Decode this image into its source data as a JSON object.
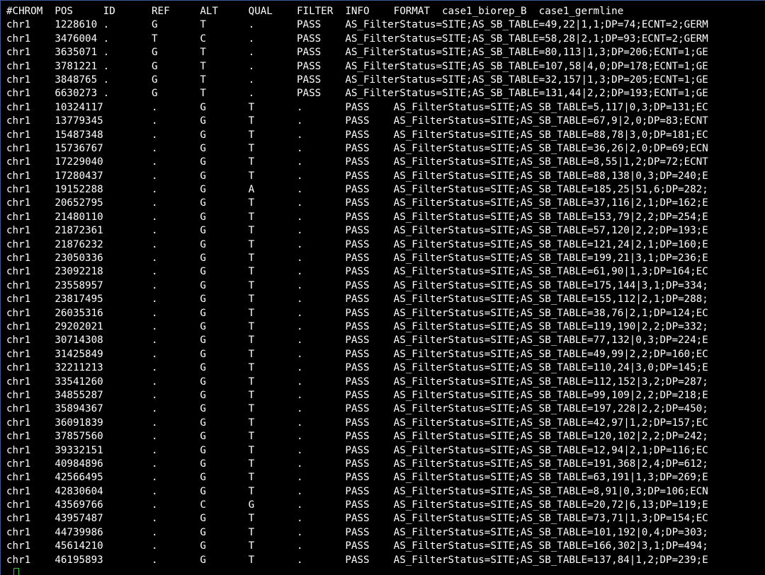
{
  "terminal": {
    "lines": [
      "#CHROM\tPOS\tID\tREF\tALT\tQUAL\tFILTER\tINFO\tFORMAT\tcase1_biorep_B\tcase1_germline",
      "chr1\t1228610\t.\tG\tT\t.\tPASS\tAS_FilterStatus=SITE;AS_SB_TABLE=49,22|1,1;DP=74;ECNT=2;GERM",
      "chr1\t3476004\t.\tT\tC\t.\tPASS\tAS_FilterStatus=SITE;AS_SB_TABLE=58,28|2,1;DP=93;ECNT=2;GERM",
      "chr1\t3635071\t.\tG\tT\t.\tPASS\tAS_FilterStatus=SITE;AS_SB_TABLE=80,113|1,3;DP=206;ECNT=1;GE",
      "chr1\t3781221\t.\tG\tT\t.\tPASS\tAS_FilterStatus=SITE;AS_SB_TABLE=107,58|4,0;DP=178;ECNT=1;GE",
      "chr1\t3848765\t.\tG\tT\t.\tPASS\tAS_FilterStatus=SITE;AS_SB_TABLE=32,157|1,3;DP=205;ECNT=1;GE",
      "chr1\t6630273\t.\tG\tT\t.\tPASS\tAS_FilterStatus=SITE;AS_SB_TABLE=131,44|2,2;DP=193;ECNT=1;GE",
      "chr1\t10324117\t.\tG\tT\t.\tPASS\tAS_FilterStatus=SITE;AS_SB_TABLE=5,117|0,3;DP=131;EC",
      "chr1\t13779345\t.\tG\tT\t.\tPASS\tAS_FilterStatus=SITE;AS_SB_TABLE=67,9|2,0;DP=83;ECNT",
      "chr1\t15487348\t.\tG\tT\t.\tPASS\tAS_FilterStatus=SITE;AS_SB_TABLE=88,78|3,0;DP=181;EC",
      "chr1\t15736767\t.\tG\tT\t.\tPASS\tAS_FilterStatus=SITE;AS_SB_TABLE=36,26|2,0;DP=69;ECN",
      "chr1\t17229040\t.\tG\tT\t.\tPASS\tAS_FilterStatus=SITE;AS_SB_TABLE=8,55|1,2;DP=72;ECNT",
      "chr1\t17280437\t.\tG\tT\t.\tPASS\tAS_FilterStatus=SITE;AS_SB_TABLE=88,138|0,3;DP=240;E",
      "chr1\t19152288\t.\tG\tA\t.\tPASS\tAS_FilterStatus=SITE;AS_SB_TABLE=185,25|51,6;DP=282;",
      "chr1\t20652795\t.\tG\tT\t.\tPASS\tAS_FilterStatus=SITE;AS_SB_TABLE=37,116|2,1;DP=162;E",
      "chr1\t21480110\t.\tG\tT\t.\tPASS\tAS_FilterStatus=SITE;AS_SB_TABLE=153,79|2,2;DP=254;E",
      "chr1\t21872361\t.\tG\tT\t.\tPASS\tAS_FilterStatus=SITE;AS_SB_TABLE=57,120|2,2;DP=193;E",
      "chr1\t21876232\t.\tG\tT\t.\tPASS\tAS_FilterStatus=SITE;AS_SB_TABLE=121,24|2,1;DP=160;E",
      "chr1\t23050336\t.\tG\tT\t.\tPASS\tAS_FilterStatus=SITE;AS_SB_TABLE=199,21|3,1;DP=236;E",
      "chr1\t23092218\t.\tG\tT\t.\tPASS\tAS_FilterStatus=SITE;AS_SB_TABLE=61,90|1,3;DP=164;EC",
      "chr1\t23558957\t.\tG\tT\t.\tPASS\tAS_FilterStatus=SITE;AS_SB_TABLE=175,144|3,1;DP=334;",
      "chr1\t23817495\t.\tG\tT\t.\tPASS\tAS_FilterStatus=SITE;AS_SB_TABLE=155,112|2,1;DP=288;",
      "chr1\t26035316\t.\tG\tT\t.\tPASS\tAS_FilterStatus=SITE;AS_SB_TABLE=38,76|2,1;DP=124;EC",
      "chr1\t29202021\t.\tG\tT\t.\tPASS\tAS_FilterStatus=SITE;AS_SB_TABLE=119,190|2,2;DP=332;",
      "chr1\t30714308\t.\tG\tT\t.\tPASS\tAS_FilterStatus=SITE;AS_SB_TABLE=77,132|0,3;DP=224;E",
      "chr1\t31425849\t.\tG\tT\t.\tPASS\tAS_FilterStatus=SITE;AS_SB_TABLE=49,99|2,2;DP=160;EC",
      "chr1\t32211213\t.\tG\tT\t.\tPASS\tAS_FilterStatus=SITE;AS_SB_TABLE=110,24|3,0;DP=145;E",
      "chr1\t33541260\t.\tG\tT\t.\tPASS\tAS_FilterStatus=SITE;AS_SB_TABLE=112,152|3,2;DP=287;",
      "chr1\t34855287\t.\tG\tT\t.\tPASS\tAS_FilterStatus=SITE;AS_SB_TABLE=99,109|2,2;DP=218;E",
      "chr1\t35894367\t.\tG\tT\t.\tPASS\tAS_FilterStatus=SITE;AS_SB_TABLE=197,228|2,2;DP=450;",
      "chr1\t36091839\t.\tG\tT\t.\tPASS\tAS_FilterStatus=SITE;AS_SB_TABLE=42,97|1,2;DP=157;EC",
      "chr1\t37857560\t.\tG\tT\t.\tPASS\tAS_FilterStatus=SITE;AS_SB_TABLE=120,102|2,2;DP=242;",
      "chr1\t39332151\t.\tG\tT\t.\tPASS\tAS_FilterStatus=SITE;AS_SB_TABLE=12,94|2,1;DP=116;EC",
      "chr1\t40984896\t.\tG\tT\t.\tPASS\tAS_FilterStatus=SITE;AS_SB_TABLE=191,368|2,4;DP=612;",
      "chr1\t42566495\t.\tG\tT\t.\tPASS\tAS_FilterStatus=SITE;AS_SB_TABLE=63,191|1,3;DP=269;E",
      "chr1\t42830604\t.\tG\tT\t.\tPASS\tAS_FilterStatus=SITE;AS_SB_TABLE=8,91|0,3;DP=106;ECN",
      "chr1\t43569766\t.\tC\tG\t.\tPASS\tAS_FilterStatus=SITE;AS_SB_TABLE=20,72|6,13;DP=119;E",
      "chr1\t43957487\t.\tG\tT\t.\tPASS\tAS_FilterStatus=SITE;AS_SB_TABLE=73,71|1,3;DP=154;EC",
      "chr1\t44739986\t.\tG\tT\t.\tPASS\tAS_FilterStatus=SITE;AS_SB_TABLE=101,192|0,4;DP=303;",
      "chr1\t45614210\t.\tG\tT\t.\tPASS\tAS_FilterStatus=SITE;AS_SB_TABLE=166,302|3,1;DP=494;",
      "chr1\t46195893\t.\tG\tT\t.\tPASS\tAS_FilterStatus=SITE;AS_SB_TABLE=137,84|1,2;DP=239;E"
    ],
    "cursor_color": "#2ecc40"
  }
}
